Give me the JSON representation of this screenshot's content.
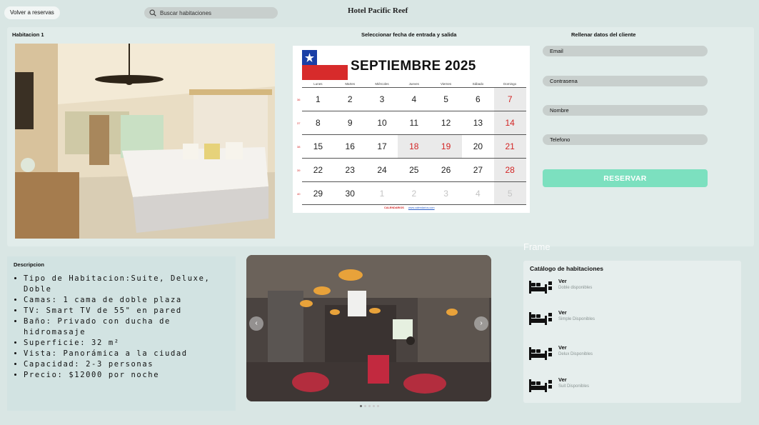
{
  "header": {
    "back_label": "Volver a reservas",
    "search_placeholder": "Buscar habitaciones",
    "hotel_name": "Hotel Pacific Reef"
  },
  "room": {
    "title": "Habitacion 1"
  },
  "calendar_section": {
    "title": "Seleccionar fecha de entrada y salida",
    "month": "SEPTIEMBRE 2025",
    "weekdays": [
      "Lunes",
      "Martes",
      "Miércoles",
      "Jueves",
      "Viernes",
      "Sábado",
      "Domingo"
    ],
    "weeks": [
      [
        "1",
        "2",
        "3",
        "4",
        "5",
        "6",
        "7"
      ],
      [
        "8",
        "9",
        "10",
        "11",
        "12",
        "13",
        "14"
      ],
      [
        "15",
        "16",
        "17",
        "18",
        "19",
        "20",
        "21"
      ],
      [
        "22",
        "23",
        "24",
        "25",
        "26",
        "27",
        "28"
      ],
      [
        "29",
        "30",
        "1",
        "2",
        "3",
        "4",
        "5"
      ]
    ],
    "week_numbers": [
      "36",
      "37",
      "38",
      "39",
      "40"
    ],
    "footer_brand": "CALENDARIOS",
    "footer_url": "www.calendarios.com"
  },
  "client_form": {
    "title": "Rellenar datos del cliente",
    "email_placeholder": "Email",
    "password_placeholder": "Contrasena",
    "name_placeholder": "Nombre",
    "phone_placeholder": "Telefono",
    "reserve_label": "RESERVAR"
  },
  "frame_label": "Frame",
  "description": {
    "title": "Descripcion",
    "items": [
      "Tipo de Habitacion:Suite, Deluxe, Doble",
      "Camas: 1 cama de doble plaza",
      "TV: Smart TV de 55\" en pared",
      "Baño: Privado con ducha de hidromasaje",
      "Superficie: 32 m²",
      "Vista: Panorámica a la ciudad",
      "Capacidad: 2-3 personas",
      "Precio: $12000 por noche"
    ]
  },
  "carousel": {
    "prev": "‹",
    "next": "›",
    "slide_count": 5,
    "active_index": 0
  },
  "catalog": {
    "title": "Catálogo de habitaciones",
    "items": [
      {
        "link": "Ver",
        "subtitle": "Doble disponibles"
      },
      {
        "link": "Ver",
        "subtitle": "Simple Disponibles"
      },
      {
        "link": "Ver",
        "subtitle": "Delux Disponibles"
      },
      {
        "link": "Ver",
        "subtitle": "Suit Disponibles"
      }
    ]
  },
  "colors": {
    "background": "#d9e6e4",
    "panel": "#e1ecea",
    "reserve_button": "#7ce0bf",
    "calendar_red": "#d32525",
    "field": "#c8cfcd"
  }
}
